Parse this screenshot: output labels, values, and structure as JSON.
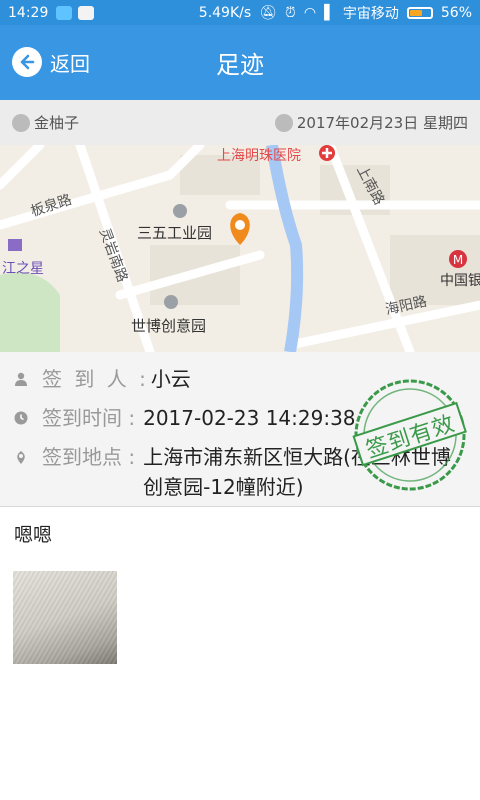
{
  "status_bar": {
    "time": "14:29",
    "network_speed": "5.49K/s",
    "carrier": "宇宙移动",
    "battery": "56%",
    "battery_level": 0.56
  },
  "header": {
    "back_label": "返回",
    "title": "足迹"
  },
  "info_bar": {
    "user": "金柚子",
    "date": "2017年02月23日 星期四"
  },
  "map": {
    "labels": [
      "上海明珠医院",
      "上南路",
      "板泉路",
      "灵岩南路",
      "三五工业园",
      "江之星",
      "中国银",
      "海阳路",
      "世博创意园"
    ]
  },
  "details": {
    "checkin_person_label": "签 到 人 :",
    "checkin_person_value": "小云",
    "checkin_time_label": "签到时间 :",
    "checkin_time_value": "2017-02-23 14:29:38",
    "checkin_location_label": "签到地点 :",
    "checkin_location_value": "上海市浦东新区恒大路(在三林世博创意园-12幢附近)",
    "stamp_text": "签到有效"
  },
  "comment": "嗯嗯",
  "colors": {
    "header": "#3896e3",
    "status_bar": "#2e8fdb",
    "stamp": "#3a9a4a",
    "pin": "#f08a1c",
    "river": "#a5c8f5"
  }
}
